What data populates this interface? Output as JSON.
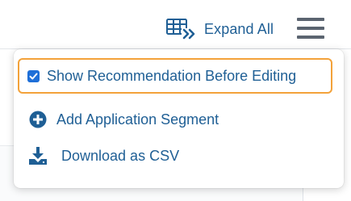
{
  "toolbar": {
    "expand_all_label": "Expand All",
    "expand_icon": "table-expand-icon",
    "menu_icon": "hamburger-menu-icon"
  },
  "menu": {
    "items": [
      {
        "label": "Show Recommendation Before Editing",
        "icon": "checkbox-checked",
        "checked": true,
        "focused": true
      },
      {
        "label": "Add Application Segment",
        "icon": "plus-circle-icon"
      },
      {
        "label": "Download as CSV",
        "icon": "download-icon"
      }
    ]
  },
  "colors": {
    "link_blue": "#1f5f95",
    "focus_orange": "#f3a23a",
    "checkbox_blue": "#1e6fd8",
    "icon_gray": "#5b6470"
  }
}
